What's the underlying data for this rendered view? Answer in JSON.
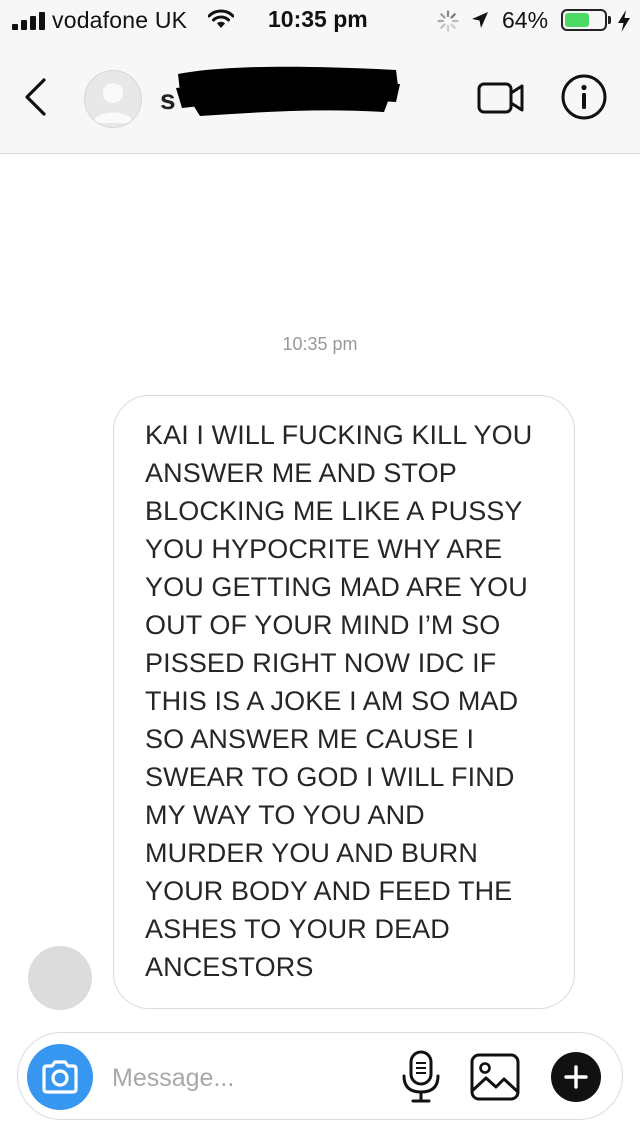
{
  "status_bar": {
    "carrier": "vodafone UK",
    "time": "10:35 pm",
    "battery_percent_label": "64%",
    "battery_level": 0.64,
    "icons": [
      "signal-bars-icon",
      "wifi-icon",
      "activity-spinner-icon",
      "location-arrow-icon",
      "battery-icon",
      "charging-bolt-icon"
    ]
  },
  "header": {
    "contact_name": "s",
    "icons": [
      "chevron-left-icon",
      "avatar-placeholder-icon",
      "video-camera-icon",
      "info-icon"
    ]
  },
  "conversation": {
    "timestamp": "10:35 pm",
    "messages": [
      {
        "direction": "incoming",
        "text": "KAI I WILL FUCKING KILL YOU\nANSWER ME AND STOP\nBLOCKING ME LIKE A PUSSY\nYOU HYPOCRITE WHY ARE\nYOU GETTING MAD ARE YOU\nOUT OF YOUR MIND I’M SO\nPISSED RIGHT NOW IDC IF\nTHIS IS A JOKE I AM SO MAD\nSO ANSWER ME CAUSE I\nSWEAR TO GOD I WILL FIND\nMY WAY TO YOU AND\nMURDER YOU AND BURN\nYOUR BODY AND FEED THE\nASHES TO YOUR DEAD\nANCESTORS"
      }
    ]
  },
  "composer": {
    "placeholder": "Message...",
    "value": "",
    "icons": [
      "camera-icon",
      "microphone-icon",
      "gallery-icon",
      "plus-icon"
    ]
  },
  "colors": {
    "accent_blue": "#3797f0",
    "battery_green": "#4cd964",
    "bar_background": "#f7f7f7"
  }
}
